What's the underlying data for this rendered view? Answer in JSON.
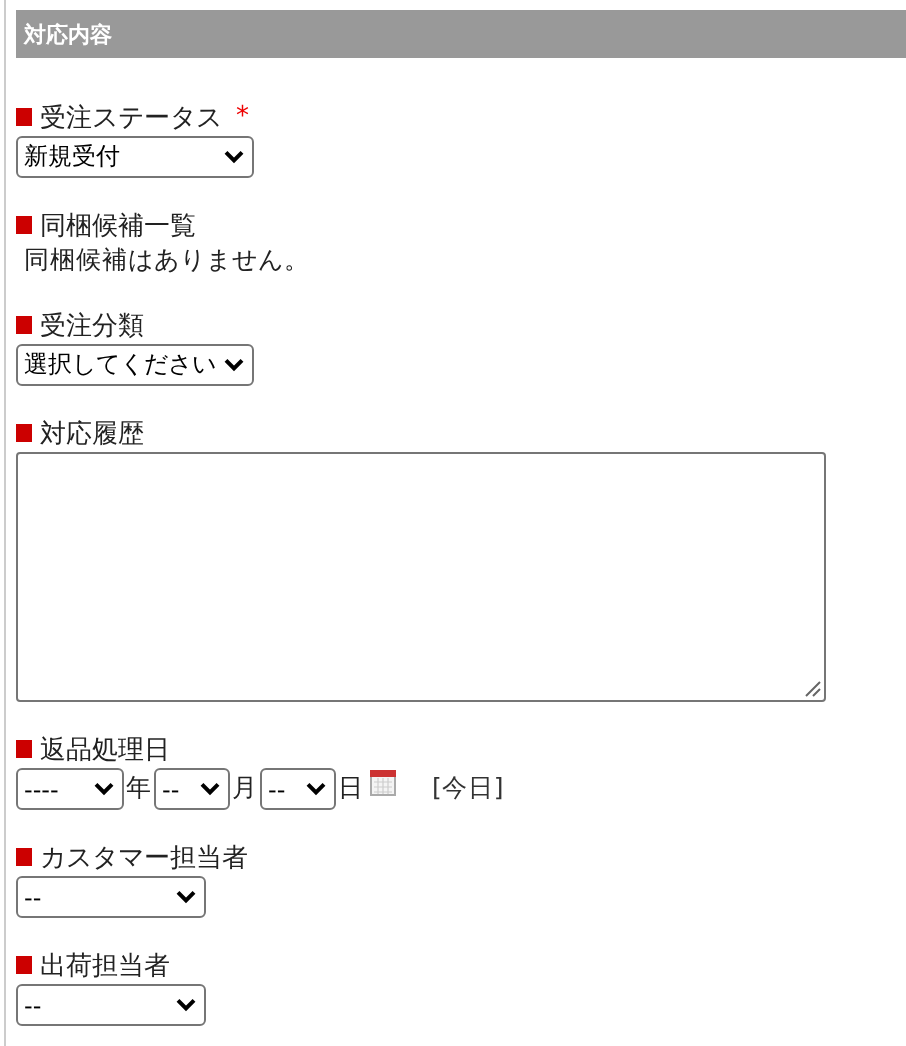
{
  "section_title": "対応内容",
  "fields": [
    {
      "kind": "select",
      "label": "受注ステータス",
      "required_mark": "*",
      "value": "新規受付"
    },
    {
      "kind": "text",
      "label": "同梱候補一覧",
      "text": "同梱候補はありません。"
    },
    {
      "kind": "select",
      "label": "受注分類",
      "value": "選択してください"
    },
    {
      "kind": "textarea",
      "label": "対応履歴"
    },
    {
      "kind": "date",
      "label": "返品処理日",
      "year": "----",
      "year_unit": "年",
      "month": "--",
      "month_unit": "月",
      "day": "--",
      "day_unit": "日",
      "today_link": "[今日]"
    },
    {
      "kind": "select",
      "label": "カスタマー担当者",
      "value": "--"
    },
    {
      "kind": "select",
      "label": "出荷担当者",
      "value": "--"
    }
  ]
}
